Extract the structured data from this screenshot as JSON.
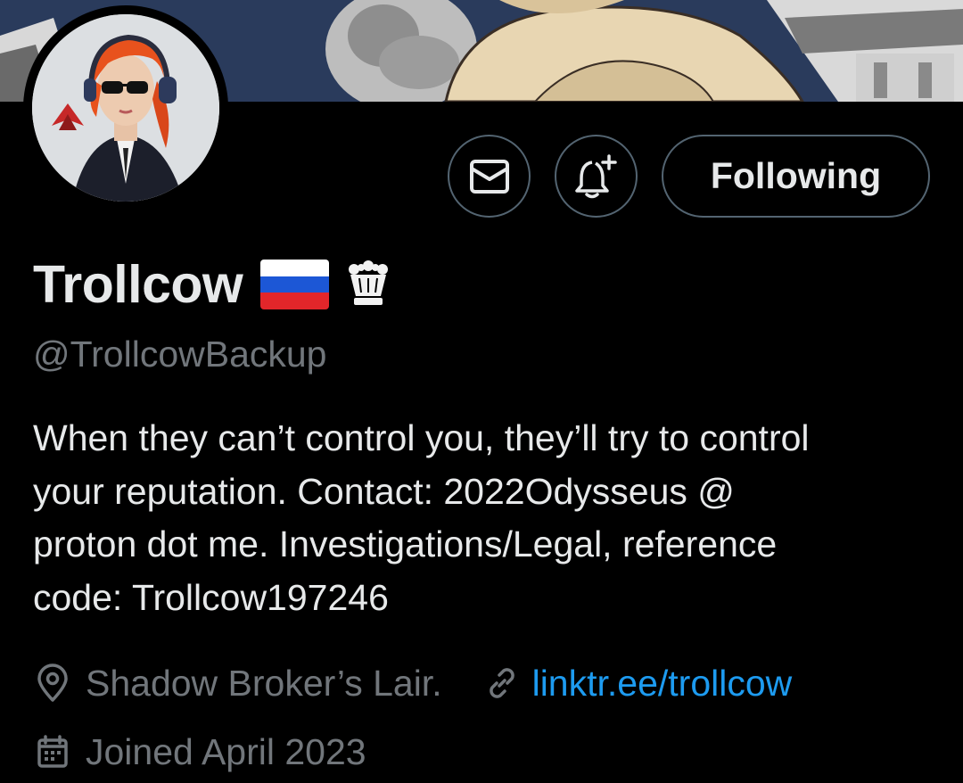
{
  "colors": {
    "background": "#000000",
    "primary_text": "#e7e9ea",
    "secondary_text": "#71767b",
    "button_border": "#536471",
    "link": "#1d9bf0"
  },
  "banner": {
    "icon": "banner-image"
  },
  "avatar": {
    "icon": "avatar-image"
  },
  "actions": {
    "message_icon": "envelope-icon",
    "notify_icon": "bell-plus-icon",
    "follow_label": "Following"
  },
  "profile": {
    "display_name": "Trollcow",
    "name_badges": [
      "russian-flag-emoji",
      "crown-emoji"
    ],
    "handle": "@TrollcowBackup",
    "bio_lines": [
      "When they can’t control you, they’ll try to control",
      "your reputation. Contact: 2022Odysseus @",
      "proton dot me. Investigations/Legal, reference",
      "code: Trollcow197246"
    ],
    "location_icon": "location-pin-icon",
    "location": "Shadow Broker’s Lair.",
    "link_icon": "link-icon",
    "link": "linktr.ee/trollcow",
    "joined_icon": "calendar-icon",
    "joined": "Joined April 2023"
  }
}
